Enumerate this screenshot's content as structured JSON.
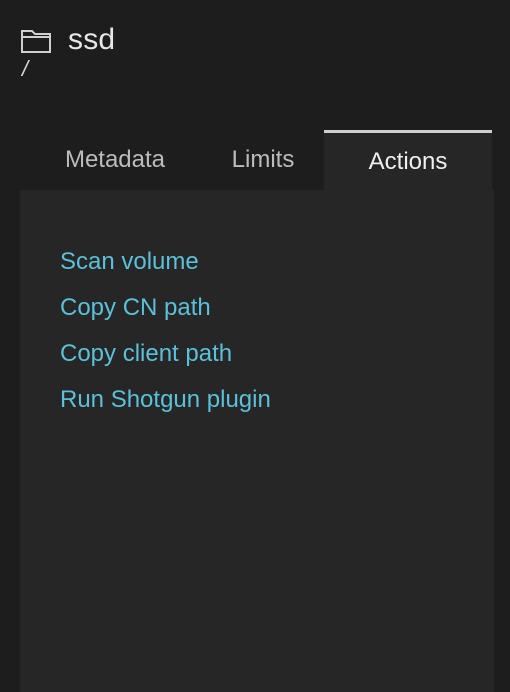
{
  "header": {
    "icon": "folder-icon",
    "title": "ssd",
    "path": "/"
  },
  "tabs": [
    {
      "label": "Metadata",
      "active": false
    },
    {
      "label": "Limits",
      "active": false
    },
    {
      "label": "Actions",
      "active": true
    }
  ],
  "actions": [
    {
      "label": "Scan volume"
    },
    {
      "label": "Copy CN path"
    },
    {
      "label": "Copy client path"
    },
    {
      "label": "Run Shotgun plugin"
    }
  ],
  "colors": {
    "background": "#1d1d1d",
    "panel": "#262626",
    "link": "#5bc0d9",
    "active_tab_border": "#cfcfcf"
  }
}
